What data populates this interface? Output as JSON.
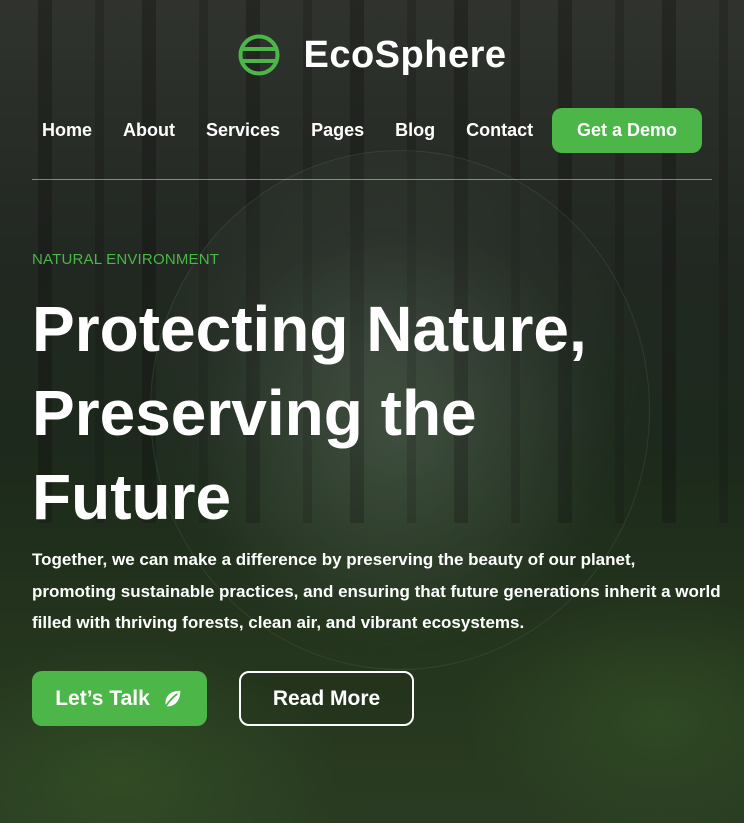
{
  "brand": {
    "name": "EcoSphere",
    "logo_icon": "globe-icon",
    "accent_color": "#4cb648"
  },
  "nav": {
    "items": [
      {
        "label": "Home"
      },
      {
        "label": "About"
      },
      {
        "label": "Services"
      },
      {
        "label": "Pages"
      },
      {
        "label": "Blog"
      },
      {
        "label": "Contact"
      }
    ],
    "cta_label": "Get a Demo"
  },
  "hero": {
    "eyebrow": "NATURAL ENVIRONMENT",
    "headline_line1": "Protecting Nature,",
    "headline_line2": "Preserving the",
    "headline_line3": "Future",
    "description": "Together, we can make a difference by preserving the beauty of our planet, promoting sustainable practices, and ensuring that future generations inherit a world filled with thriving forests, clean air, and vibrant ecosystems.",
    "primary_button": {
      "label": "Let’s Talk",
      "icon": "leaf-icon"
    },
    "secondary_button": {
      "label": "Read More"
    }
  }
}
